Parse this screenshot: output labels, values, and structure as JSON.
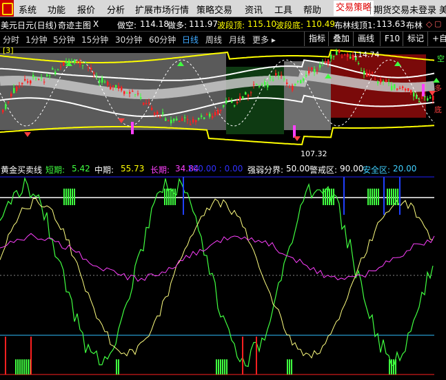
{
  "menu": {
    "items": [
      "系统",
      "功能",
      "报价",
      "分析",
      "扩展市场行情",
      "策略交易",
      "资讯",
      "工具",
      "帮助"
    ],
    "active": "交易策略",
    "status": "期货交易未登录",
    "cut": "美"
  },
  "header": {
    "instrument": "美元日元(日线)",
    "indicator": "奇迹主图",
    "close_mark": "X",
    "fields": [
      {
        "label": "做空:",
        "value": "114.18",
        "color": "#ffffff"
      },
      {
        "label": "做多:",
        "value": "111.97",
        "color": "#ffffff"
      },
      {
        "label": "波段顶:",
        "value": "115.10",
        "color": "#ffff00"
      },
      {
        "label": "波段底:",
        "value": "110.49",
        "color": "#ffff00"
      },
      {
        "label": "布林线顶1:",
        "value": "113.63",
        "color": "#ffffff"
      },
      {
        "label": "布林",
        "value": "",
        "color": "#ffffff"
      }
    ]
  },
  "tabs": {
    "periods": [
      "分时",
      "1分钟",
      "5分钟",
      "15分钟",
      "30分钟",
      "60分钟",
      "日线",
      "周线",
      "月线",
      "更多 ▸"
    ],
    "active_period": "日线",
    "tools": [
      "指标",
      "叠加",
      "画线",
      "F10",
      "标记",
      "+自选"
    ]
  },
  "price_chart": {
    "low_label": "107.32",
    "high_label": "114.74",
    "box_label": "[3]",
    "labels_right": [
      "空",
      "多",
      "底"
    ],
    "colors": {
      "up": "#ff2020",
      "down": "#40ff40",
      "band": "#ffff00",
      "dashed": "#ffffff",
      "mid": "#c8c8c8"
    }
  },
  "sub_header": {
    "name": "黄金买卖线",
    "short_label": "短期:",
    "short_value": "5.42",
    "mid_label": "中期:",
    "mid_value": "55.73",
    "long_label": "长期:",
    "long_value": "34.84",
    "blue_text": "100.00 : 0.00",
    "strength_label": "强弱分界:",
    "strength_value": "50.00",
    "warn_label": "警戒区:",
    "warn_value": "90.00",
    "safe_label": "安全区:",
    "safe_value": "20.00"
  }
}
